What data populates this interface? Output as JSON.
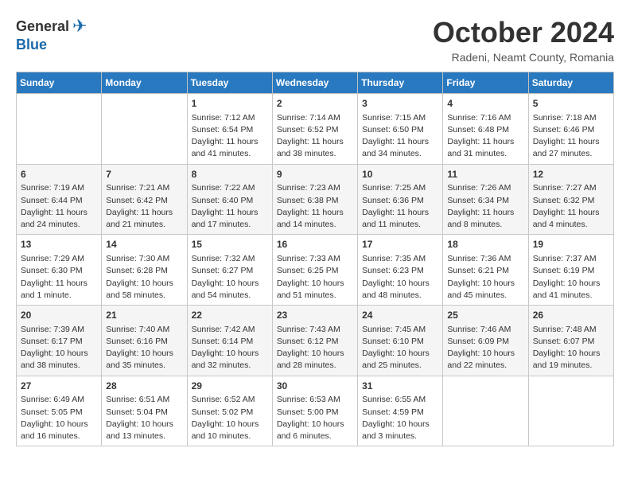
{
  "header": {
    "logo_general": "General",
    "logo_blue": "Blue",
    "month_title": "October 2024",
    "subtitle": "Radeni, Neamt County, Romania"
  },
  "days_of_week": [
    "Sunday",
    "Monday",
    "Tuesday",
    "Wednesday",
    "Thursday",
    "Friday",
    "Saturday"
  ],
  "weeks": [
    [
      {
        "day": "",
        "info": ""
      },
      {
        "day": "",
        "info": ""
      },
      {
        "day": "1",
        "info": "Sunrise: 7:12 AM\nSunset: 6:54 PM\nDaylight: 11 hours and 41 minutes."
      },
      {
        "day": "2",
        "info": "Sunrise: 7:14 AM\nSunset: 6:52 PM\nDaylight: 11 hours and 38 minutes."
      },
      {
        "day": "3",
        "info": "Sunrise: 7:15 AM\nSunset: 6:50 PM\nDaylight: 11 hours and 34 minutes."
      },
      {
        "day": "4",
        "info": "Sunrise: 7:16 AM\nSunset: 6:48 PM\nDaylight: 11 hours and 31 minutes."
      },
      {
        "day": "5",
        "info": "Sunrise: 7:18 AM\nSunset: 6:46 PM\nDaylight: 11 hours and 27 minutes."
      }
    ],
    [
      {
        "day": "6",
        "info": "Sunrise: 7:19 AM\nSunset: 6:44 PM\nDaylight: 11 hours and 24 minutes."
      },
      {
        "day": "7",
        "info": "Sunrise: 7:21 AM\nSunset: 6:42 PM\nDaylight: 11 hours and 21 minutes."
      },
      {
        "day": "8",
        "info": "Sunrise: 7:22 AM\nSunset: 6:40 PM\nDaylight: 11 hours and 17 minutes."
      },
      {
        "day": "9",
        "info": "Sunrise: 7:23 AM\nSunset: 6:38 PM\nDaylight: 11 hours and 14 minutes."
      },
      {
        "day": "10",
        "info": "Sunrise: 7:25 AM\nSunset: 6:36 PM\nDaylight: 11 hours and 11 minutes."
      },
      {
        "day": "11",
        "info": "Sunrise: 7:26 AM\nSunset: 6:34 PM\nDaylight: 11 hours and 8 minutes."
      },
      {
        "day": "12",
        "info": "Sunrise: 7:27 AM\nSunset: 6:32 PM\nDaylight: 11 hours and 4 minutes."
      }
    ],
    [
      {
        "day": "13",
        "info": "Sunrise: 7:29 AM\nSunset: 6:30 PM\nDaylight: 11 hours and 1 minute."
      },
      {
        "day": "14",
        "info": "Sunrise: 7:30 AM\nSunset: 6:28 PM\nDaylight: 10 hours and 58 minutes."
      },
      {
        "day": "15",
        "info": "Sunrise: 7:32 AM\nSunset: 6:27 PM\nDaylight: 10 hours and 54 minutes."
      },
      {
        "day": "16",
        "info": "Sunrise: 7:33 AM\nSunset: 6:25 PM\nDaylight: 10 hours and 51 minutes."
      },
      {
        "day": "17",
        "info": "Sunrise: 7:35 AM\nSunset: 6:23 PM\nDaylight: 10 hours and 48 minutes."
      },
      {
        "day": "18",
        "info": "Sunrise: 7:36 AM\nSunset: 6:21 PM\nDaylight: 10 hours and 45 minutes."
      },
      {
        "day": "19",
        "info": "Sunrise: 7:37 AM\nSunset: 6:19 PM\nDaylight: 10 hours and 41 minutes."
      }
    ],
    [
      {
        "day": "20",
        "info": "Sunrise: 7:39 AM\nSunset: 6:17 PM\nDaylight: 10 hours and 38 minutes."
      },
      {
        "day": "21",
        "info": "Sunrise: 7:40 AM\nSunset: 6:16 PM\nDaylight: 10 hours and 35 minutes."
      },
      {
        "day": "22",
        "info": "Sunrise: 7:42 AM\nSunset: 6:14 PM\nDaylight: 10 hours and 32 minutes."
      },
      {
        "day": "23",
        "info": "Sunrise: 7:43 AM\nSunset: 6:12 PM\nDaylight: 10 hours and 28 minutes."
      },
      {
        "day": "24",
        "info": "Sunrise: 7:45 AM\nSunset: 6:10 PM\nDaylight: 10 hours and 25 minutes."
      },
      {
        "day": "25",
        "info": "Sunrise: 7:46 AM\nSunset: 6:09 PM\nDaylight: 10 hours and 22 minutes."
      },
      {
        "day": "26",
        "info": "Sunrise: 7:48 AM\nSunset: 6:07 PM\nDaylight: 10 hours and 19 minutes."
      }
    ],
    [
      {
        "day": "27",
        "info": "Sunrise: 6:49 AM\nSunset: 5:05 PM\nDaylight: 10 hours and 16 minutes."
      },
      {
        "day": "28",
        "info": "Sunrise: 6:51 AM\nSunset: 5:04 PM\nDaylight: 10 hours and 13 minutes."
      },
      {
        "day": "29",
        "info": "Sunrise: 6:52 AM\nSunset: 5:02 PM\nDaylight: 10 hours and 10 minutes."
      },
      {
        "day": "30",
        "info": "Sunrise: 6:53 AM\nSunset: 5:00 PM\nDaylight: 10 hours and 6 minutes."
      },
      {
        "day": "31",
        "info": "Sunrise: 6:55 AM\nSunset: 4:59 PM\nDaylight: 10 hours and 3 minutes."
      },
      {
        "day": "",
        "info": ""
      },
      {
        "day": "",
        "info": ""
      }
    ]
  ]
}
